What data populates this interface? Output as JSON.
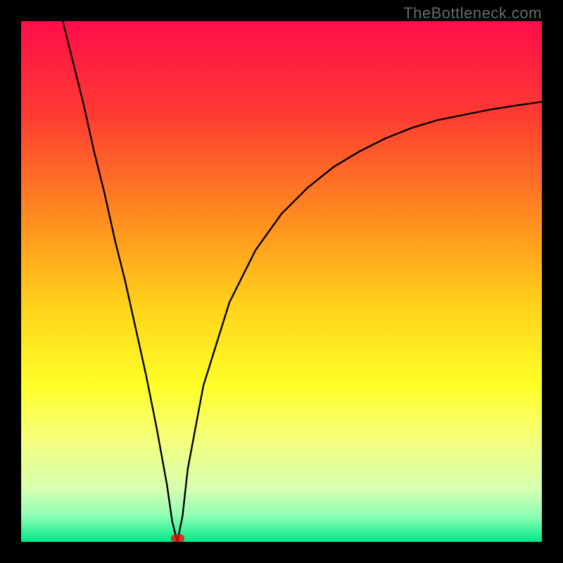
{
  "watermark": "TheBottleneck.com",
  "chart_data": {
    "type": "line",
    "title": "",
    "xlabel": "",
    "ylabel": "",
    "xlim": [
      0,
      100
    ],
    "ylim": [
      0,
      100
    ],
    "grid": false,
    "legend": false,
    "background_gradient": {
      "stops": [
        {
          "pct": 0,
          "color": "#ff0d4a"
        },
        {
          "pct": 18,
          "color": "#ff3b32"
        },
        {
          "pct": 38,
          "color": "#ff8d1f"
        },
        {
          "pct": 55,
          "color": "#ffd41a"
        },
        {
          "pct": 70,
          "color": "#ffff28"
        },
        {
          "pct": 80,
          "color": "#f6ff7a"
        },
        {
          "pct": 90,
          "color": "#d4ffb0"
        },
        {
          "pct": 95,
          "color": "#8effb4"
        },
        {
          "pct": 100,
          "color": "#00e88a"
        }
      ]
    },
    "series": [
      {
        "name": "bottleneck-curve",
        "color": "#000000",
        "x": [
          8,
          10,
          12,
          14,
          16,
          18,
          20,
          22,
          24,
          26,
          28,
          29,
          30,
          31,
          32,
          35,
          40,
          45,
          50,
          55,
          60,
          65,
          70,
          75,
          80,
          85,
          90,
          95,
          100
        ],
        "values": [
          100,
          92,
          84,
          75,
          67,
          58,
          50,
          41,
          32,
          22,
          11,
          4,
          0,
          5,
          14,
          30,
          46,
          56,
          63,
          68,
          72,
          75,
          77.5,
          79.5,
          81,
          82,
          83,
          83.8,
          84.5
        ]
      }
    ],
    "annotations": [
      {
        "name": "min-marker",
        "x": 30,
        "y": 0,
        "color": "rgba(255,0,0,0.75)"
      }
    ]
  }
}
